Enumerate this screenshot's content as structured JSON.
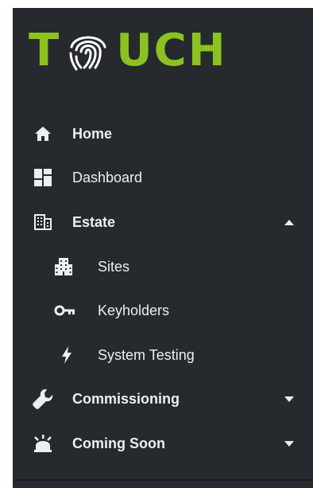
{
  "logo": {
    "left": "T",
    "right": "UCH"
  },
  "nav": {
    "home": "Home",
    "dashboard": "Dashboard",
    "estate": "Estate",
    "sites": "Sites",
    "keyholders": "Keyholders",
    "system_testing": "System Testing",
    "commissioning": "Commissioning",
    "coming_soon": "Coming Soon"
  },
  "icons": {
    "home": "home-icon",
    "dashboard": "dashboard-icon",
    "estate": "building-icon",
    "sites": "city-icon",
    "keyholders": "key-icon",
    "system_testing": "lightning-icon",
    "commissioning": "wrench-icon",
    "coming_soon": "bell-alert-icon"
  },
  "colors": {
    "sidebar_bg": "#262a2e",
    "text": "#eceff1",
    "brand_green": "#8bc220"
  }
}
